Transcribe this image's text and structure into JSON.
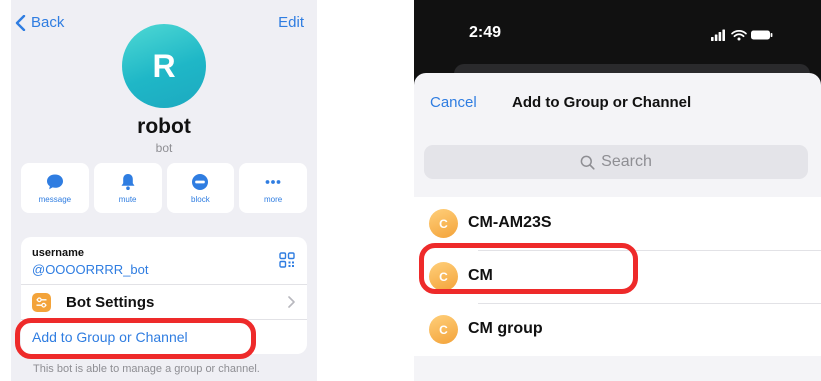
{
  "left": {
    "nav": {
      "back_label": "Back",
      "edit_label": "Edit"
    },
    "profile": {
      "avatar_letter": "R",
      "name": "robot",
      "subtitle": "bot"
    },
    "actions": [
      {
        "label": "message",
        "icon": "message-icon"
      },
      {
        "label": "mute",
        "icon": "bell-icon"
      },
      {
        "label": "block",
        "icon": "block-icon"
      },
      {
        "label": "more",
        "icon": "more-icon"
      }
    ],
    "username": {
      "label": "username",
      "value": "@OOOORRRR_bot"
    },
    "bot_settings_label": "Bot Settings",
    "add_to_group_label": "Add to Group or Channel",
    "footer_note": "This bot is able to manage a group or channel."
  },
  "right": {
    "status": {
      "time": "2:49"
    },
    "sheet": {
      "cancel_label": "Cancel",
      "title": "Add to Group or Channel"
    },
    "search": {
      "placeholder": "Search"
    },
    "chats": [
      {
        "initial": "C",
        "name": "CM-AM23S"
      },
      {
        "initial": "C",
        "name": "CM"
      },
      {
        "initial": "C",
        "name": "CM group"
      }
    ]
  },
  "colors": {
    "accent": "#2f7de1",
    "highlight": "#ee2a2a",
    "bot_avatar": "#1fb7c7",
    "chat_avatar": "#f3a33a"
  }
}
